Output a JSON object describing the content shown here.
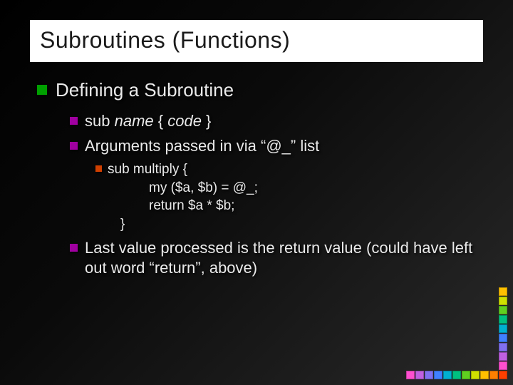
{
  "title": "Subroutines (Functions)",
  "lvl1": {
    "text": "Defining a Subroutine"
  },
  "lvl2": {
    "i0_pre": "sub ",
    "i0_name": "name",
    "i0_mid": " { ",
    "i0_code": "code",
    "i0_post": " }",
    "i1": "Arguments passed in via “@_” list",
    "i2": "Last value processed is the return value (could have left out word “return”, above)"
  },
  "lvl3": {
    "pre": "sub multiply {",
    "l1": "my ($a, $b)  =  @_;",
    "l2": "return $a * $b;",
    "close": "}"
  },
  "deco_colors": {
    "row0": [
      "#ff4fcf",
      "#c060e0",
      "#8070f0",
      "#4080ff",
      "#00b0d0",
      "#00c080",
      "#60d020",
      "#d0e000",
      "#ffc000",
      "#ff8000",
      "#ff4000"
    ],
    "col": [
      "#ff4fcf",
      "#c060e0",
      "#8070f0",
      "#4080ff",
      "#00b0d0",
      "#00c080",
      "#60d020",
      "#d0e000",
      "#ffc000"
    ]
  }
}
